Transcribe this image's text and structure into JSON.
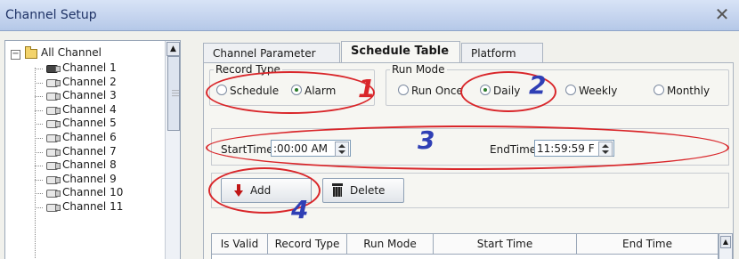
{
  "window": {
    "title": "Channel Setup",
    "close_glyph": "✕"
  },
  "tree": {
    "root_label": "All Channel",
    "expander_glyph": "−",
    "scroll_up_glyph": "▲",
    "channels": [
      "Channel 1",
      "Channel 2",
      "Channel 3",
      "Channel 4",
      "Channel 5",
      "Channel 6",
      "Channel 7",
      "Channel 8",
      "Channel 9",
      "Channel 10",
      "Channel 11"
    ]
  },
  "tabs": [
    {
      "label": "Channel Parameter",
      "active": false
    },
    {
      "label": "Schedule Table",
      "active": true
    },
    {
      "label": "Platform",
      "active": false
    }
  ],
  "record_type": {
    "legend": "Record Type",
    "options": [
      {
        "label": "Schedule",
        "selected": false
      },
      {
        "label": "Alarm",
        "selected": true
      }
    ]
  },
  "run_mode": {
    "legend": "Run Mode",
    "options": [
      {
        "label": "Run Once",
        "selected": false
      },
      {
        "label": "Daily",
        "selected": true
      },
      {
        "label": "Weekly",
        "selected": false
      },
      {
        "label": "Monthly",
        "selected": false
      }
    ]
  },
  "time": {
    "start_label": "StartTime",
    "start_value": ":00:00 AM",
    "end_label": "EndTime",
    "end_value": "11:59:59 F"
  },
  "buttons": {
    "add": "Add",
    "delete": "Delete"
  },
  "table": {
    "columns": [
      "Is Valid",
      "Record Type",
      "Run Mode",
      "Start Time",
      "End Time"
    ],
    "scroll_up_glyph": "▲"
  },
  "annotations": {
    "numbers": [
      "1",
      "2",
      "3",
      "4"
    ],
    "ellipse_color": "#d9262a",
    "number_colors": [
      "#d9262a",
      "#2f3fb5",
      "#2f3fb5",
      "#2f3fb5"
    ]
  }
}
